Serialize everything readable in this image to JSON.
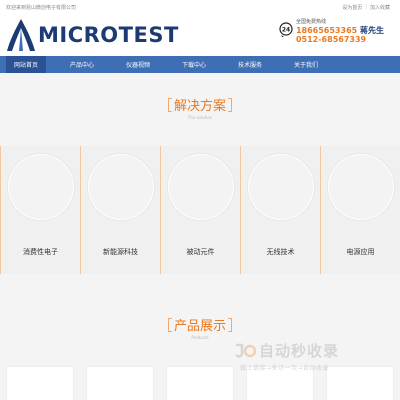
{
  "topbar": {
    "left_text": "欢迎来到昆山微创电子有限公司",
    "links": [
      "设为首页",
      "加入收藏"
    ]
  },
  "header": {
    "logo_text": "MICROTEST",
    "hotline_label": "全国免费热线",
    "phone1": "18665653365",
    "contact": "蒋先生",
    "phone2": "0512-68567339",
    "badge_number": "24"
  },
  "nav": {
    "items": [
      "网站首页",
      "产品中心",
      "仪器视频",
      "下载中心",
      "技术服务",
      "关于我们"
    ],
    "active_index": 0
  },
  "solutions": {
    "title": "解决方案",
    "subtitle": "The solution",
    "items": [
      "消费性电子",
      "新能源科技",
      "被动元件",
      "无线技术",
      "电源应用"
    ]
  },
  "products": {
    "title": "产品展示",
    "subtitle": "Products"
  },
  "watermark": {
    "main": "自动秒收录",
    "sub": "做上链接→来访一次→自动收录"
  },
  "colors": {
    "nav_bg": "#3e6eb4",
    "nav_active": "#2a5294",
    "accent": "#e87a24",
    "logo": "#1d3b73"
  }
}
